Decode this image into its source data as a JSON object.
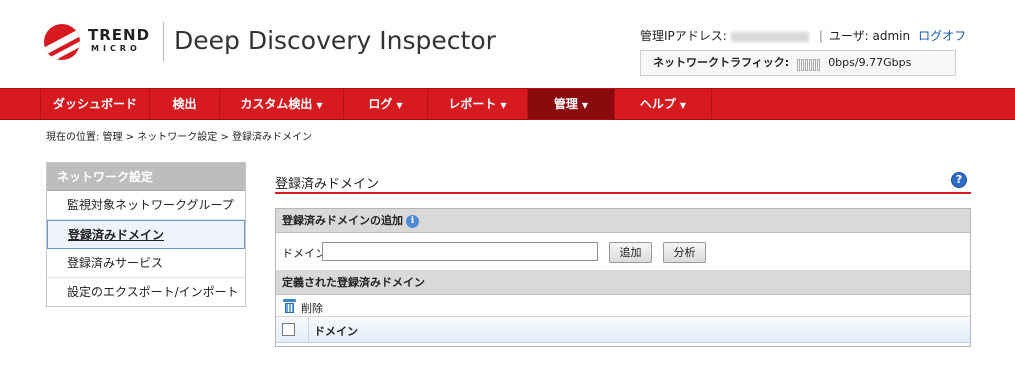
{
  "header": {
    "brand_line1": "TREND",
    "brand_line2": "MICRO",
    "product_title": "Deep Discovery Inspector",
    "mgmt_ip_label": "管理IPアドレス:",
    "user_label": "ユーザ: admin",
    "logoff_label": "ログオフ",
    "traffic_label": "ネットワークトラフィック:",
    "traffic_value": "0bps/9.77Gbps"
  },
  "nav": {
    "items": [
      {
        "label": "ダッシュボード",
        "has_menu": false
      },
      {
        "label": "検出",
        "has_menu": false
      },
      {
        "label": "カスタム検出",
        "has_menu": true
      },
      {
        "label": "ログ",
        "has_menu": true
      },
      {
        "label": "レポート",
        "has_menu": true
      },
      {
        "label": "管理",
        "has_menu": true,
        "active": true
      },
      {
        "label": "ヘルプ",
        "has_menu": true
      }
    ]
  },
  "breadcrumb": "現在の位置: 管理 > ネットワーク設定 > 登録済みドメイン",
  "sidebar": {
    "title": "ネットワーク設定",
    "items": [
      {
        "label": "監視対象ネットワークグループ"
      },
      {
        "label": "登録済みドメイン",
        "selected": true
      },
      {
        "label": "登録済みサービス"
      },
      {
        "label": "設定のエクスポート/インポート"
      }
    ]
  },
  "main": {
    "title": "登録済みドメイン",
    "add_section_title": "登録済みドメインの追加",
    "domain_label": "ドメイン:",
    "domain_value": "",
    "add_button": "追加",
    "analyze_button": "分析",
    "defined_section_title": "定義された登録済みドメイン",
    "delete_label": "削除",
    "column_domain": "ドメイン"
  },
  "colors": {
    "brand_red": "#d71920",
    "nav_active": "#8a0a0e",
    "link_blue": "#1a5aa8"
  },
  "icons": [
    "trend-micro-logo",
    "help-icon",
    "info-icon",
    "trash-icon",
    "chevron-down-icon"
  ]
}
